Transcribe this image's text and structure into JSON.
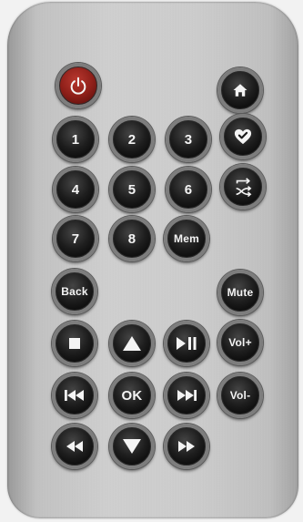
{
  "remote": {
    "buttons": {
      "power": {
        "icon": "power-icon"
      },
      "home": {
        "icon": "home-icon"
      },
      "num_1": {
        "label": "1"
      },
      "num_2": {
        "label": "2"
      },
      "num_3": {
        "label": "3"
      },
      "favorite": {
        "icon": "heart-check-icon"
      },
      "num_4": {
        "label": "4"
      },
      "num_5": {
        "label": "5"
      },
      "num_6": {
        "label": "6"
      },
      "repeat_shuffle": {
        "icon": "repeat-shuffle-icon"
      },
      "num_7": {
        "label": "7"
      },
      "num_8": {
        "label": "8"
      },
      "mem": {
        "label": "Mem"
      },
      "back": {
        "label": "Back"
      },
      "mute": {
        "label": "Mute"
      },
      "stop": {
        "icon": "stop-icon"
      },
      "up": {
        "icon": "up-arrow-icon"
      },
      "play_pause": {
        "icon": "play-pause-icon"
      },
      "vol_up": {
        "label": "Vol+"
      },
      "prev": {
        "icon": "skip-previous-icon"
      },
      "ok": {
        "label": "OK"
      },
      "next": {
        "icon": "skip-next-icon"
      },
      "vol_down": {
        "label": "Vol-"
      },
      "rewind": {
        "icon": "rewind-icon"
      },
      "down": {
        "icon": "down-arrow-icon"
      },
      "fast_forward": {
        "icon": "fast-forward-icon"
      }
    },
    "colors": {
      "body": "#c8c8c8",
      "button": "#1a1a1a",
      "button_ring": "#7d7d7d",
      "power_button": "#8e1f19",
      "glyph": "#f4f4f4"
    }
  }
}
